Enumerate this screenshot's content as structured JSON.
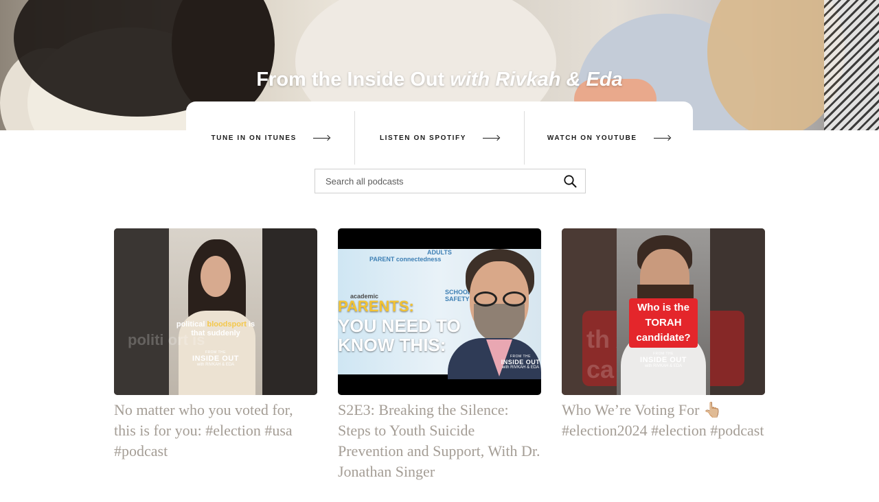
{
  "hero": {
    "title_main": "From the Inside Out",
    "title_italic": "with Rivkah & Eda"
  },
  "listen": {
    "itunes": "TUNE IN ON ITUNES",
    "spotify": "LISTEN ON SPOTIFY",
    "youtube": "WATCH ON YOUTUBE"
  },
  "search": {
    "placeholder": "Search all podcasts"
  },
  "episodes": [
    {
      "title": "No matter who you voted for, this is for you: #election #usa #podcast",
      "thumb_caption_pre": "political ",
      "thumb_caption_hl": "bloodsport",
      "thumb_caption_post": " is that suddenly",
      "thumb_ghost": "politi          ort is",
      "thumb_brand_1": "FROM THE",
      "thumb_brand_2": "INSIDE OUT",
      "thumb_brand_3": "with RIVKAH & EDA"
    },
    {
      "title": "S2E3: Breaking the Silence: Steps to Youth Suicide Prevention and Support, With Dr. Jonathan Singer",
      "thumb_tag_1": "PARENT connectedness",
      "thumb_tag_2": "ADULTS",
      "thumb_tag_3": "SCHOOL SAFETY",
      "thumb_tag_4": "academic",
      "thumb_head_1": "PARENTS:",
      "thumb_head_2": "YOU NEED TO",
      "thumb_head_3": "KNOW THIS:",
      "thumb_brand_1": "FROM THE",
      "thumb_brand_2": "INSIDE OUT",
      "thumb_brand_3": "with RIVKAH & EDA"
    },
    {
      "title": "Who We’re Voting For 👆🏼 #election2024 #election #podcast",
      "thumb_label": "Who is the TORAH candidate?",
      "thumb_ghost_1": "th         AH",
      "thumb_ghost_2": "ca          e?",
      "thumb_brand_1": "FROM THE",
      "thumb_brand_2": "INSIDE OUT",
      "thumb_brand_3": "with RIVKAH & EDA"
    }
  ]
}
